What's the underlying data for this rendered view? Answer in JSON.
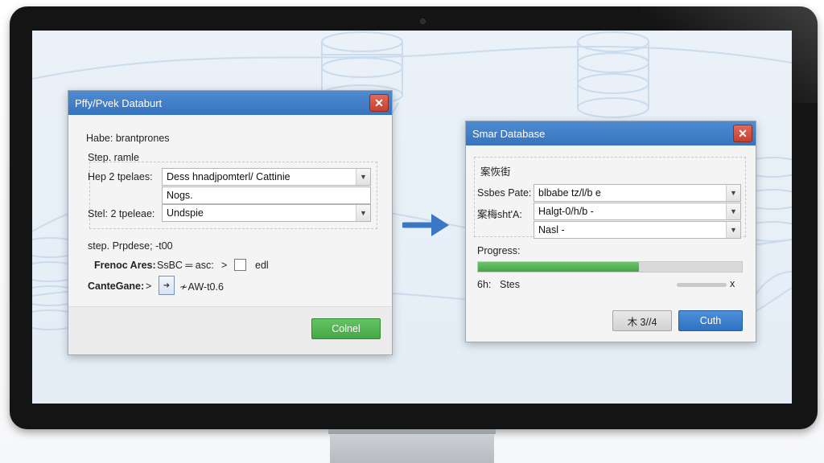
{
  "left_dialog": {
    "title": "Pffy/Pvek Databurt",
    "close_glyph": "✕",
    "header_text": "Habe: brantprones",
    "step_label": "Step. ramle",
    "row1_label": "Hep 2 tpelaes:",
    "row1_value": "Dess hnadjpomterl/ Cattinie",
    "row1_sub_value": "Nogs.",
    "row2_label": "Stel: 2 tpeleae:",
    "row2_value": "Undspie",
    "step_purpose": "step. Prpdese; -t00",
    "frenoc_label": "Frenoc Ares:",
    "frenoc_value": "SsBC ═ asc:",
    "frenoc_chevron": ">",
    "frenoc_check_label": "edl",
    "cantegane_label": "CanteGane:",
    "cantegane_chevron": ">",
    "file_glyph": "➜",
    "file_name": "≁AW-t0.6",
    "ok_button": "Colnel"
  },
  "right_dialog": {
    "title": "Smar Database",
    "close_glyph": "✕",
    "group_caption": "案恢街",
    "row1_label": "Ssbes Pate:",
    "row1_value": "blbabe tz/l/b e",
    "row2_label": "案梅sht'A:",
    "row2_value": "Halgt-0/h/b -",
    "row3_value": "Nasl -",
    "progress_label": "Progress:",
    "progress_fraction": 0.61,
    "status_label": "6h:",
    "status_value": "Stes",
    "status_close": "x",
    "cancel_button": "木 3//4",
    "ok_button": "Cuth"
  },
  "colors": {
    "titlebar": "#3774bf",
    "close_red": "#c6402f",
    "ok_green": "#44a844",
    "primary_blue": "#2f72c2",
    "progress_green": "#46a546",
    "flow_arrow": "#3a78c4"
  }
}
